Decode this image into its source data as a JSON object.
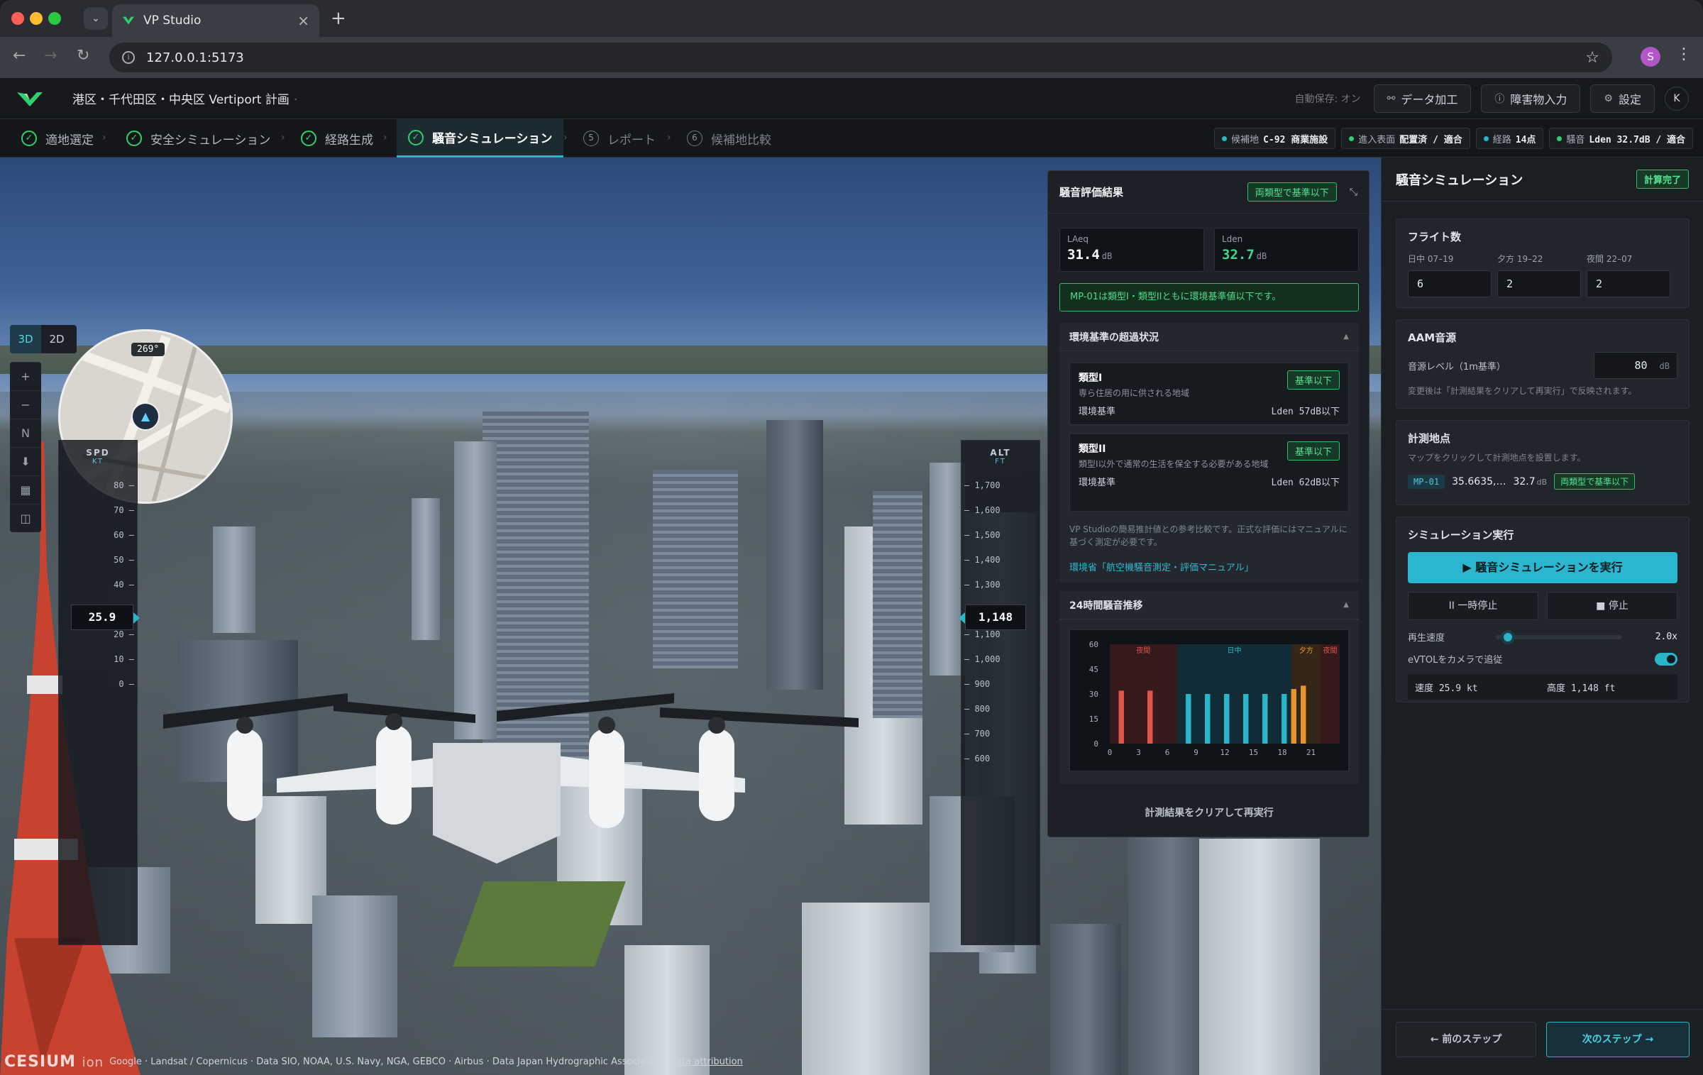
{
  "browser": {
    "tab_title": "VP Studio",
    "url": "127.0.0.1:5173"
  },
  "app": {
    "project_title": "港区・千代田区・中央区 Vertiport 計画",
    "autosave": "自動保存: オン",
    "buttons": {
      "data": "データ加工",
      "obstacle": "障害物入力",
      "settings": "設定",
      "user": "K"
    }
  },
  "steps": [
    {
      "label": "適地選定",
      "state": "done"
    },
    {
      "label": "安全シミュレーション",
      "state": "done"
    },
    {
      "label": "経路生成",
      "state": "done"
    },
    {
      "label": "騒音シミュレーション",
      "state": "active"
    },
    {
      "label": "レポート",
      "num": "5",
      "state": "todo"
    },
    {
      "label": "候補地比較",
      "num": "6",
      "state": "todo"
    }
  ],
  "status_chips": [
    {
      "key": "候補地",
      "value": "C-92 商業施設"
    },
    {
      "key": "進入表面",
      "value": "配置済 / 適合"
    },
    {
      "key": "経路",
      "value": "14点"
    },
    {
      "key": "騒音",
      "value": "Lden 32.7dB / 適合"
    }
  ],
  "map": {
    "view_3d": "3D",
    "view_2d": "2D",
    "tools": [
      "+",
      "−",
      "N",
      "⬇",
      "▦",
      "◫"
    ],
    "heading": "269°",
    "speed_tape": {
      "label": "SPD",
      "unit": "KT",
      "ticks": [
        "80",
        "70",
        "60",
        "50",
        "40",
        "20",
        "10",
        "0"
      ],
      "value": "25.9"
    },
    "alt_tape": {
      "label": "ALT",
      "unit": "FT",
      "ticks": [
        "1,700",
        "1,600",
        "1,500",
        "1,400",
        "1,300",
        "1,100",
        "1,000",
        "900",
        "800",
        "700",
        "600"
      ],
      "value": "1,148"
    },
    "attribution": "Google · Landsat / Copernicus · Data SIO, NOAA, U.S. Navy, NGA, GEBCO · Airbus · Data Japan Hydrographic Association",
    "attribution_link": "Data attribution",
    "cesium_text": "CESIUM",
    "cesium_ion": "ion"
  },
  "noise_panel": {
    "title": "騒音評価結果",
    "badge": "両類型で基準以下",
    "laeq": {
      "label": "LAeq",
      "value": "31.4",
      "unit": "dB"
    },
    "lden": {
      "label": "Lden",
      "value": "32.7",
      "unit": "dB"
    },
    "ok_message": "MP-01は類型I・類型IIともに環境基準値以下です。",
    "exceed_title": "環境基準の超過状況",
    "zone1": {
      "title": "類型I",
      "desc": "専ら住居の用に供される地域",
      "std_label": "環境基準",
      "std_value": "Lden 57dB以下",
      "badge": "基準以下"
    },
    "zone2": {
      "title": "類型II",
      "desc": "類型I以外で通常の生活を保全する必要がある地域",
      "std_label": "環境基準",
      "std_value": "Lden 62dB以下",
      "badge": "基準以下"
    },
    "note": "VP Studioの簡易推計値との参考比較です。正式な評価にはマニュアルに基づく測定が必要です。",
    "link": "環境省「航空機騒音測定・評価マニュアル」",
    "chart_title": "24時間騒音推移",
    "rerun": "計測結果をクリアして再実行"
  },
  "chart_data": {
    "type": "bar",
    "x": [
      0,
      1,
      2,
      3,
      4,
      5,
      6,
      7,
      8,
      9,
      10,
      11,
      12,
      13,
      14,
      15,
      16,
      17,
      18,
      19,
      20,
      21,
      22,
      23
    ],
    "y_ticks": [
      "60",
      "45",
      "30",
      "15",
      "0"
    ],
    "x_ticks": [
      "0",
      "3",
      "6",
      "9",
      "12",
      "15",
      "18",
      "21"
    ],
    "ylim": [
      0,
      60
    ],
    "bands": [
      {
        "label": "夜間",
        "from": 0,
        "to": 7
      },
      {
        "label": "日中",
        "from": 7,
        "to": 19
      },
      {
        "label": "夕方",
        "from": 19,
        "to": 22
      },
      {
        "label": "夜間",
        "from": 22,
        "to": 24
      }
    ],
    "bars": [
      {
        "hour": 1,
        "value": 32,
        "period": "night"
      },
      {
        "hour": 4,
        "value": 32,
        "period": "night"
      },
      {
        "hour": 8,
        "value": 30,
        "period": "day"
      },
      {
        "hour": 10,
        "value": 30,
        "period": "day"
      },
      {
        "hour": 12,
        "value": 30,
        "period": "day"
      },
      {
        "hour": 14,
        "value": 30,
        "period": "day"
      },
      {
        "hour": 16,
        "value": 30,
        "period": "day"
      },
      {
        "hour": 18,
        "value": 30,
        "period": "day"
      },
      {
        "hour": 19,
        "value": 33,
        "period": "evening"
      },
      {
        "hour": 20,
        "value": 35,
        "period": "evening"
      }
    ],
    "colors": {
      "night": "#e0544a",
      "day": "#29b6c8",
      "evening": "#e8932c"
    }
  },
  "sidebar": {
    "title": "騒音シミュレーション",
    "badge": "計算完了",
    "flights": {
      "title": "フライト数",
      "fields": [
        {
          "label": "日中 07–19",
          "value": "6"
        },
        {
          "label": "夕方 19–22",
          "value": "2"
        },
        {
          "label": "夜間 22–07",
          "value": "2"
        }
      ]
    },
    "source": {
      "title": "AAM音源",
      "label": "音源レベル（1m基準）",
      "value": "80",
      "unit": "dB",
      "note": "変更後は「計測結果をクリアして再実行」で反映されます。"
    },
    "points": {
      "title": "計測地点",
      "note": "マップをクリックして計測地点を設置します。",
      "id": "MP-01",
      "coord": "35.6635,…",
      "level": "32.7",
      "level_unit": "dB",
      "badge": "両類型で基準以下"
    },
    "run": {
      "title": "シミュレーション実行",
      "run_button": "▶ 騒音シミュレーションを実行",
      "pause": "II 一時停止",
      "stop": "■ 停止",
      "speed_label": "再生速度",
      "speed_value": "2.0x",
      "speed_fraction": 0.05,
      "follow_label": "eVTOLをカメラで追従",
      "follow_on": true,
      "speed_readout": "速度 25.9 kt",
      "alt_readout": "高度 1,148 ft"
    },
    "prev": "← 前のステップ",
    "next": "次のステップ →"
  }
}
